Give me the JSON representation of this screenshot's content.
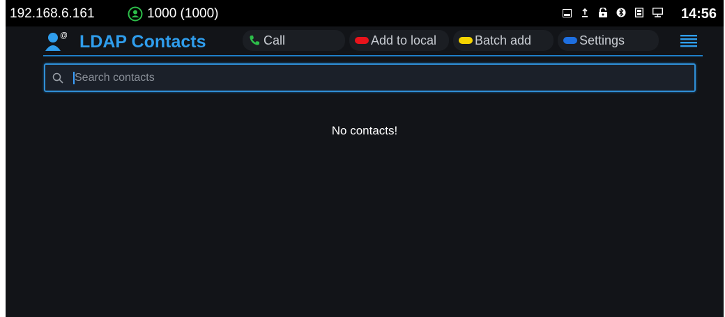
{
  "status_bar": {
    "ip_address": "192.168.6.161",
    "account": "1000 (1000)",
    "account_status_color": "#2dbe4a",
    "icons": [
      "screenshot-icon",
      "upload-icon",
      "lock-icon",
      "bluetooth-icon",
      "sd-card-icon",
      "network-icon"
    ],
    "time": "14:56"
  },
  "header": {
    "title": "LDAP Contacts",
    "accent_color": "#2f9dec",
    "softkeys": {
      "call": "Call",
      "add_to_local": "Add to local",
      "batch_add": "Batch add",
      "settings": "Settings"
    },
    "softkey_colors": {
      "call": "#2dbe4a",
      "add_to_local": "#e8131b",
      "batch_add": "#f5d400",
      "settings": "#1e6fe0"
    }
  },
  "search": {
    "value": "",
    "placeholder": "Search contacts"
  },
  "empty_state": {
    "message": "No contacts!"
  }
}
